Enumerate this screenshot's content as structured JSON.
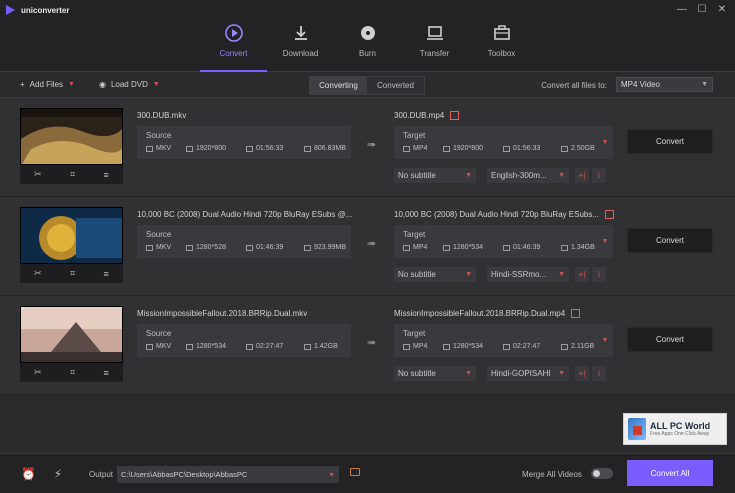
{
  "app": {
    "title": "uniconverter"
  },
  "window": {
    "minimize": "—",
    "maximize": "☐",
    "close": "✕"
  },
  "nav": {
    "items": [
      {
        "label": "Convert",
        "icon": "convert-icon",
        "active": true
      },
      {
        "label": "Download",
        "icon": "download-icon"
      },
      {
        "label": "Burn",
        "icon": "burn-icon"
      },
      {
        "label": "Transfer",
        "icon": "transfer-icon"
      },
      {
        "label": "Toolbox",
        "icon": "toolbox-icon"
      }
    ]
  },
  "toolbar": {
    "add_files": "Add Files",
    "load_dvd": "Load DVD",
    "tab_converting": "Converting",
    "tab_converted": "Converted",
    "convert_all_to": "Convert all files to:",
    "format": "MP4 Video"
  },
  "labels": {
    "source": "Source",
    "target": "Target",
    "convert": "Convert"
  },
  "tasks": [
    {
      "source_name": "300.DUB.mkv",
      "source": {
        "format": "MKV",
        "resolution": "1920*800",
        "duration": "01:56:33",
        "size": "806.83MB"
      },
      "target_name": "300.DUB.mp4",
      "target": {
        "format": "MP4",
        "resolution": "1920*800",
        "duration": "01:56:33",
        "size": "2.50GB"
      },
      "subtitle": "No subtitle",
      "audio": "English-300m..."
    },
    {
      "source_name": "10,000 BC (2008) Dual Audio Hindi 720p BluRay ESubs @...",
      "source": {
        "format": "MKV",
        "resolution": "1280*528",
        "duration": "01:46:39",
        "size": "923.99MB"
      },
      "target_name": "10,000 BC (2008) Dual Audio Hindi 720p BluRay ESubs...",
      "target": {
        "format": "MP4",
        "resolution": "1280*534",
        "duration": "01:46:39",
        "size": "1.34GB"
      },
      "subtitle": "No subtitle",
      "audio": "Hindi-SSRmo..."
    },
    {
      "source_name": "MissionImpossibleFallout.2018.BRRip.Dual.mkv",
      "source": {
        "format": "MKV",
        "resolution": "1280*534",
        "duration": "02:27:47",
        "size": "1.42GB"
      },
      "target_name": "MissionImpossibleFallout.2018.BRRip.Dual.mp4",
      "target": {
        "format": "MP4",
        "resolution": "1280*534",
        "duration": "02:27:47",
        "size": "2.11GB"
      },
      "subtitle": "No subtitle",
      "audio": "Hindi-GOPISAHI"
    }
  ],
  "watermark": {
    "title": "ALL PC World",
    "tagline": "Free Apps One Click Away"
  },
  "footer": {
    "output_label": "Output",
    "output_path": "C:\\Users\\AbbasPC\\Desktop\\AbbasPC",
    "merge_label": "Merge All Videos",
    "merge_enabled": false,
    "convert_all": "Convert All"
  }
}
